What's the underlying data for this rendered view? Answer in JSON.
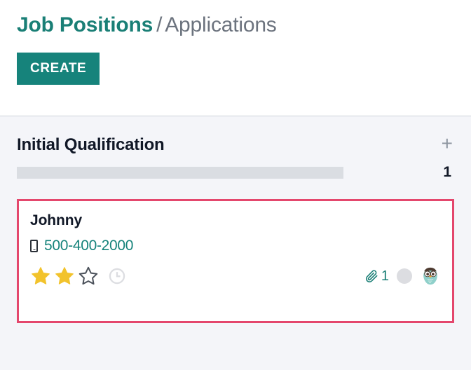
{
  "breadcrumb": {
    "root": "Job Positions",
    "separator": "/",
    "current": "Applications"
  },
  "toolbar": {
    "create_label": "CREATE"
  },
  "colors": {
    "accent_teal": "#16837b",
    "breadcrumb_link": "#1a7f76",
    "breadcrumb_muted": "#6c737e",
    "card_border_pink": "#e4476d",
    "star_gold": "#f2c32c",
    "progress_gray": "#dadde2",
    "background": "#f4f5f9"
  },
  "kanban": {
    "column": {
      "title": "Initial Qualification",
      "add_icon": "plus-icon",
      "record_count": "1",
      "progress_fill_label": ""
    },
    "cards": [
      {
        "name": "Johnny",
        "phone_icon": "mobile-phone-icon",
        "phone": "500-400-2000",
        "rating_filled": 2,
        "rating_total": 3,
        "activity_icon": "clock-icon",
        "attachment_icon": "paperclip-icon",
        "attachment_count": "1",
        "state_icon": "kanban-state-circle",
        "avatar_icon": "owl-avatar"
      }
    ]
  }
}
